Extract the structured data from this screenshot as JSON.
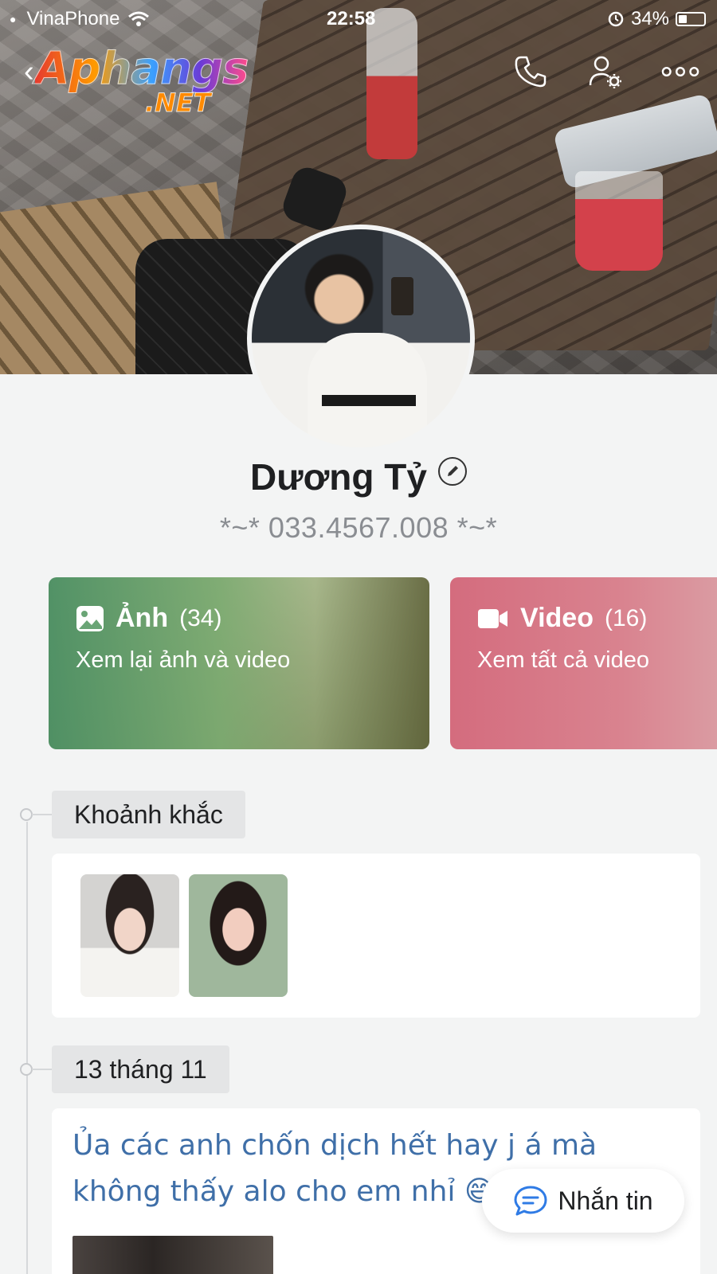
{
  "status_bar": {
    "carrier": "VinaPhone",
    "time": "22:58",
    "battery": "34%"
  },
  "brand": {
    "logo_line1": "Aphangs",
    "logo_line2": ".NET"
  },
  "header": {
    "icons": [
      "back-icon",
      "phone-icon",
      "contact-settings-icon",
      "more-icon"
    ]
  },
  "profile": {
    "name": "Dương Tỷ",
    "subtitle": "*~* 033.4567.008 *~*"
  },
  "media_cards": {
    "photos": {
      "title": "Ảnh",
      "count": "(34)",
      "desc": "Xem lại ảnh và video"
    },
    "videos": {
      "title": "Video",
      "count": "(16)",
      "desc": "Xem tất cả video"
    }
  },
  "timeline": {
    "moments_label": "Khoảnh khắc",
    "date_label": "13 tháng 11",
    "post_text": "Ủa các anh chốn dịch hết hay j á mà không thấy alo cho em nhỉ 😄😄"
  },
  "message_button": {
    "label": "Nhắn tin"
  },
  "colors": {
    "accent_blue": "#3f6fa8",
    "photos_card": "#5f9c6c",
    "videos_card": "#d46c7e",
    "background": "#f3f4f4"
  }
}
